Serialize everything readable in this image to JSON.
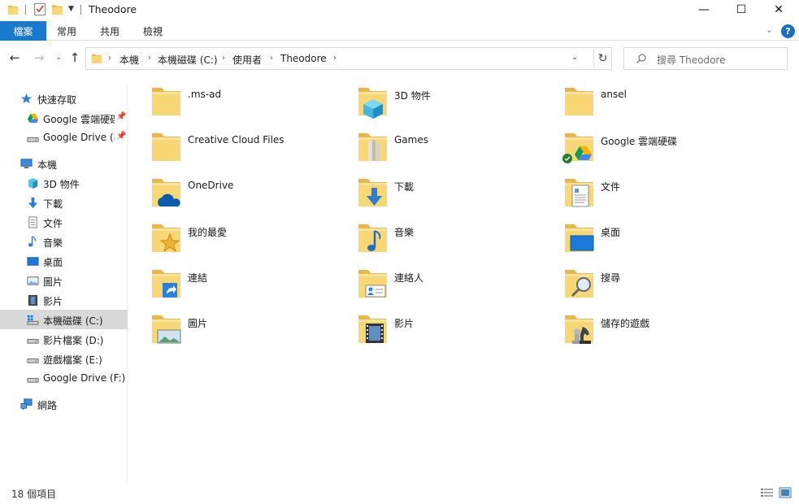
{
  "window": {
    "title": "Theodore",
    "minimize_glyph": "—",
    "maximize_glyph": "☐",
    "close_glyph": "✕"
  },
  "ribbon": {
    "file_tab": "檔案",
    "tabs": [
      "常用",
      "共用",
      "檢視"
    ],
    "help": "?"
  },
  "address": {
    "crumbs": [
      "本機",
      "本機磁碟 (C:)",
      "使用者",
      "Theodore"
    ]
  },
  "search": {
    "placeholder": "搜尋 Theodore"
  },
  "nav": {
    "quick_access": "快速存取",
    "google_cloud": "Google 雲端硬碟",
    "google_drive_pinned": "Google Drive (F:)",
    "this_pc": "本機",
    "objects3d": "3D 物件",
    "downloads": "下載",
    "documents": "文件",
    "music": "音樂",
    "desktop": "桌面",
    "pictures": "圖片",
    "videos": "影片",
    "drive_c": "本機磁碟 (C:)",
    "drive_d": "影片檔案 (D:)",
    "drive_e": "遊戲檔案 (E:)",
    "drive_f": "Google Drive (F:)",
    "network": "網路"
  },
  "files": [
    {
      "name": ".ms-ad",
      "icon": "folder-icon"
    },
    {
      "name": "3D 物件",
      "icon": "3d-objects-folder-icon"
    },
    {
      "name": "ansel",
      "icon": "folder-icon"
    },
    {
      "name": "Creative Cloud Files",
      "icon": "folder-icon"
    },
    {
      "name": "Games",
      "icon": "games-folder-icon"
    },
    {
      "name": "Google 雲端硬碟",
      "icon": "google-drive-folder-icon"
    },
    {
      "name": "OneDrive",
      "icon": "onedrive-folder-icon"
    },
    {
      "name": "下載",
      "icon": "downloads-folder-icon"
    },
    {
      "name": "文件",
      "icon": "documents-folder-icon"
    },
    {
      "name": "我的最愛",
      "icon": "favorites-folder-icon"
    },
    {
      "name": "音樂",
      "icon": "music-folder-icon"
    },
    {
      "name": "桌面",
      "icon": "desktop-folder-icon"
    },
    {
      "name": "連結",
      "icon": "links-folder-icon"
    },
    {
      "name": "連絡人",
      "icon": "contacts-folder-icon"
    },
    {
      "name": "搜尋",
      "icon": "searches-folder-icon"
    },
    {
      "name": "圖片",
      "icon": "pictures-folder-icon"
    },
    {
      "name": "影片",
      "icon": "videos-folder-icon"
    },
    {
      "name": "儲存的遊戲",
      "icon": "saved-games-folder-icon"
    }
  ],
  "status": {
    "item_count": "18 個項目"
  },
  "colors": {
    "file_tab": "#1979ca",
    "selected_nav": "#d9d9d9",
    "folder_yellow": "#f8d775"
  }
}
